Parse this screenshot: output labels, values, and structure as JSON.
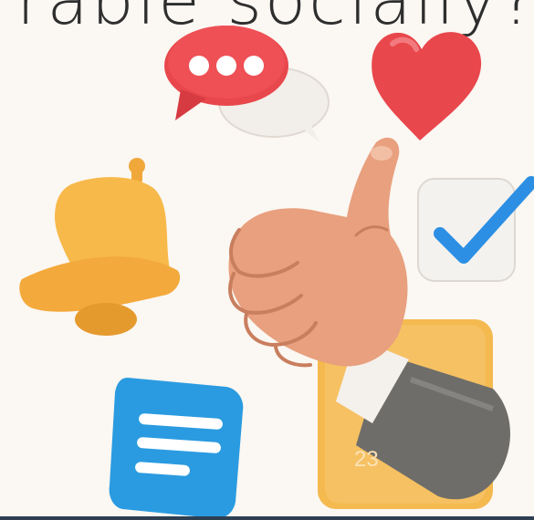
{
  "slide": {
    "title_fragment": "rable socially?",
    "page_number": "23"
  },
  "illustration": {
    "icons": [
      "speech-bubble-icon",
      "heart-icon",
      "bell-icon",
      "checkbox-icon",
      "thumbs-up-hand-icon",
      "message-lines-icon",
      "yellow-square-icon"
    ],
    "colors": {
      "background": "#FBF7F2",
      "red": "#E8474C",
      "bell_yellow": "#F7B94A",
      "message_blue": "#2A9BE0",
      "check_blue": "#2C8FE3",
      "skin": "#E8A07E",
      "sleeve_gray": "#6E6D6A",
      "square_yellow": "#F4B94F",
      "rule": "#2F3F52"
    }
  }
}
